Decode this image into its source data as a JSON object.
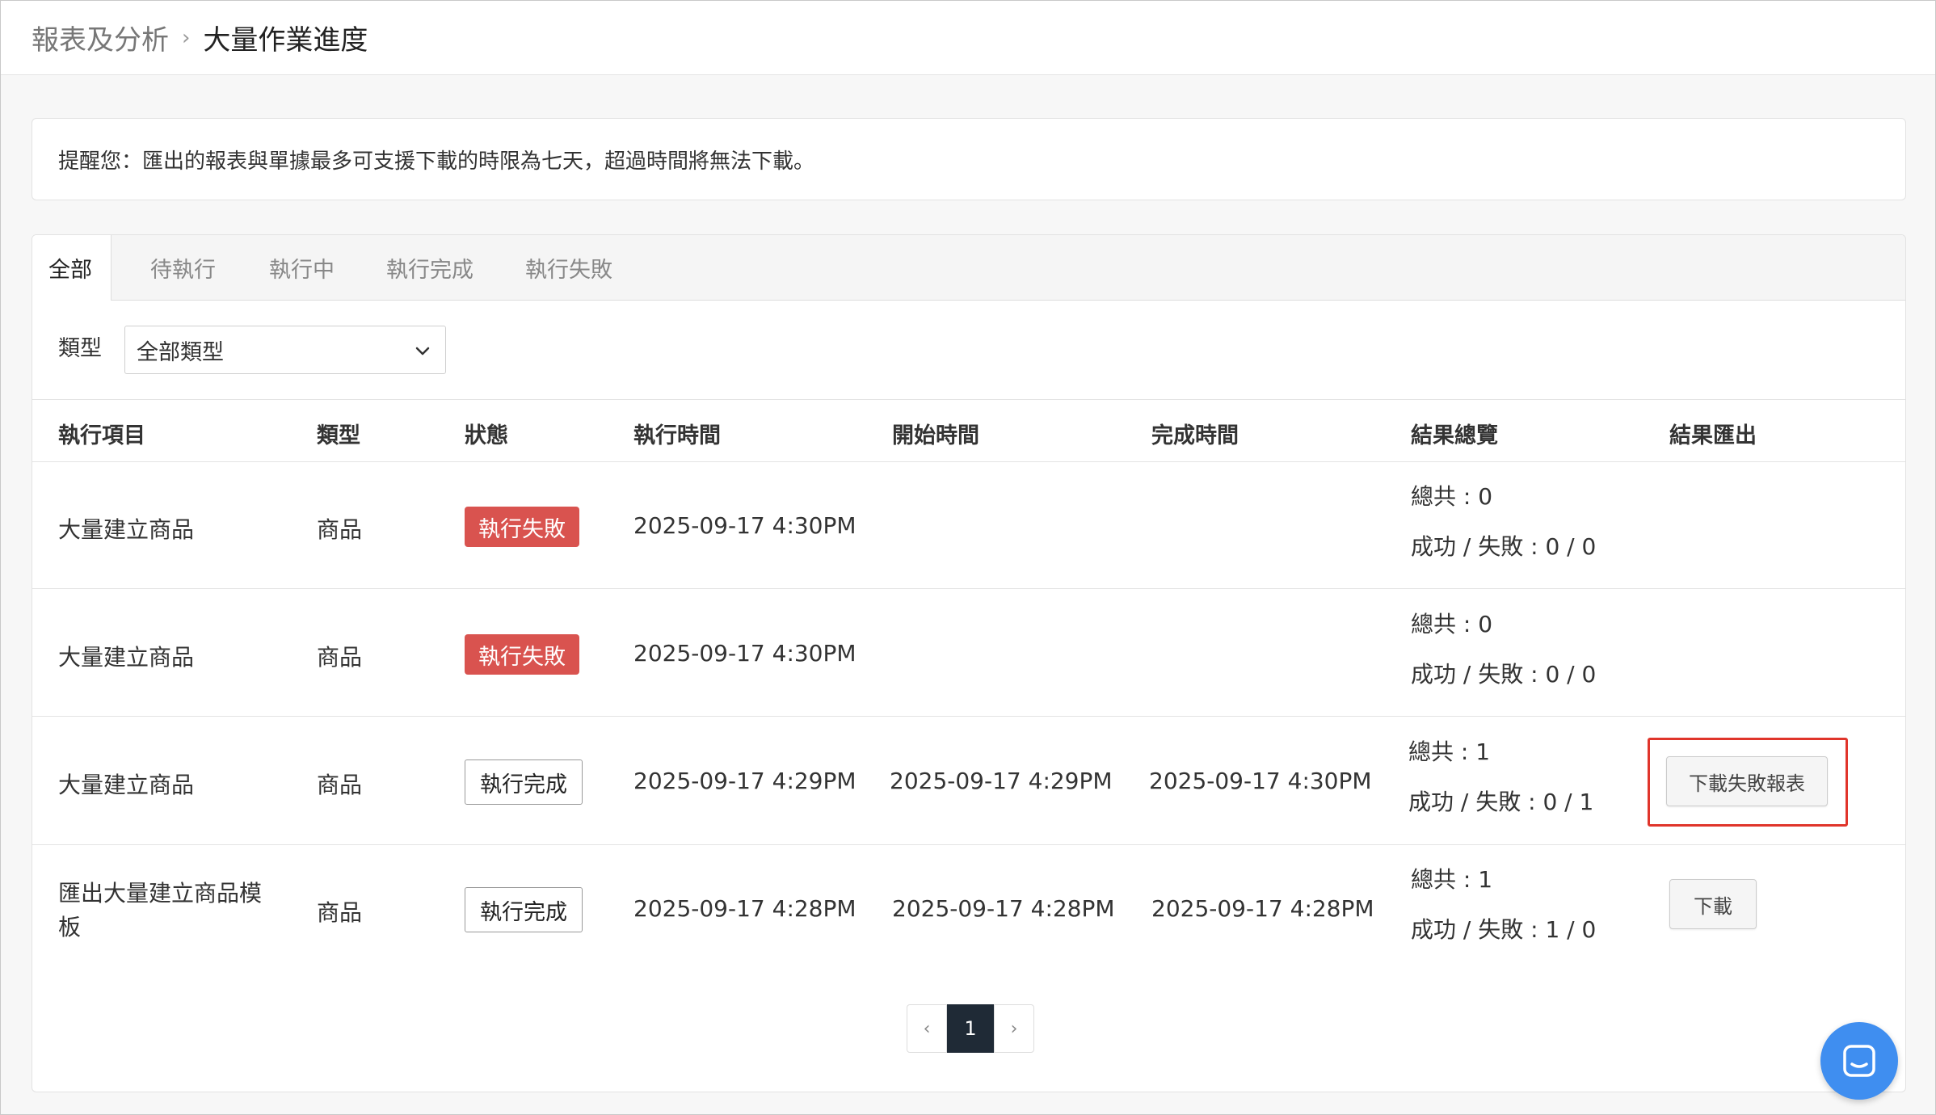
{
  "breadcrumb": {
    "parent": "報表及分析",
    "separator": "›",
    "current": "大量作業進度"
  },
  "notice": {
    "text": "提醒您：匯出的報表與單據最多可支援下載的時限為七天，超過時間將無法下載。"
  },
  "tabs": [
    {
      "label": "全部",
      "active": true
    },
    {
      "label": "待執行",
      "active": false
    },
    {
      "label": "執行中",
      "active": false
    },
    {
      "label": "執行完成",
      "active": false
    },
    {
      "label": "執行失敗",
      "active": false
    }
  ],
  "filter": {
    "label": "類型",
    "selected": "全部類型"
  },
  "table": {
    "headers": [
      "執行項目",
      "類型",
      "狀態",
      "執行時間",
      "開始時間",
      "完成時間",
      "結果總覽",
      "結果匯出"
    ],
    "rows": [
      {
        "item": "大量建立商品",
        "type": "商品",
        "status": "執行失敗",
        "exec_time": "2025-09-17 4:30PM",
        "start_time": "",
        "end_time": "",
        "total": "總共 : 0",
        "result": "成功 / 失敗 : 0 / 0",
        "export": ""
      },
      {
        "item": "大量建立商品",
        "type": "商品",
        "status": "執行失敗",
        "exec_time": "2025-09-17 4:30PM",
        "start_time": "",
        "end_time": "",
        "total": "總共 : 0",
        "result": "成功 / 失敗 : 0 / 0",
        "export": ""
      },
      {
        "item": "大量建立商品",
        "type": "商品",
        "status": "執行完成",
        "exec_time": "2025-09-17 4:29PM",
        "start_time": "2025-09-17 4:29PM",
        "end_time": "2025-09-17 4:30PM",
        "total": "總共 : 1",
        "result": "成功 / 失敗 : 0 / 1",
        "export": "下載失敗報表"
      },
      {
        "item": "匯出大量建立商品模板",
        "type": "商品",
        "status": "執行完成",
        "exec_time": "2025-09-17 4:28PM",
        "start_time": "2025-09-17 4:28PM",
        "end_time": "2025-09-17 4:28PM",
        "total": "總共 : 1",
        "result": "成功 / 失敗 : 1 / 0",
        "export": "下載"
      }
    ]
  },
  "pagination": {
    "prev": "‹",
    "current": "1",
    "next": "›"
  },
  "colors": {
    "fail_badge": "#d9534f",
    "active_page": "#1f2a36",
    "highlight": "#e0352b",
    "chat_button": "#3f8ef0"
  }
}
